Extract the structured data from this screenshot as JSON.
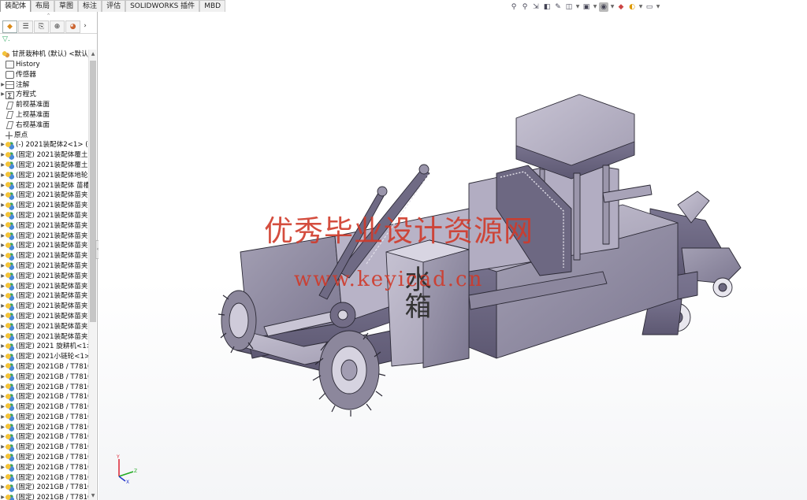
{
  "tabs": [
    "装配体",
    "布局",
    "草图",
    "标注",
    "评估",
    "SOLIDWORKS 插件",
    "MBD"
  ],
  "active_tab": 0,
  "hud_icons": [
    "search-icon",
    "zoom-area-icon",
    "previous-view-icon",
    "section-view-icon",
    "dynamic-annotation-icon",
    "view-orientation-icon",
    "display-style-icon",
    "hide-show-icon",
    "edit-appearance-icon",
    "apply-scene-icon",
    "view-settings-icon"
  ],
  "panel": {
    "tabs": [
      "feature-manager-icon",
      "property-manager-icon",
      "configuration-manager-icon",
      "dimxpert-icon",
      "display-manager-icon"
    ],
    "more": "›",
    "filter": "▽.",
    "root": "甘蔗栽种机 (默认) <默认_显",
    "tree": [
      {
        "icon": "hist",
        "label": "History",
        "arrow": ""
      },
      {
        "icon": "sens",
        "label": "传感器",
        "arrow": ""
      },
      {
        "icon": "note",
        "label": "注解",
        "arrow": "▶"
      },
      {
        "icon": "eq",
        "label": "方程式",
        "arrow": "▶"
      },
      {
        "icon": "plane",
        "label": "前视基准面",
        "arrow": ""
      },
      {
        "icon": "plane",
        "label": "上视基准面",
        "arrow": ""
      },
      {
        "icon": "plane",
        "label": "右视基准面",
        "arrow": ""
      },
      {
        "icon": "origin",
        "label": "原点",
        "arrow": ""
      },
      {
        "icon": "asm",
        "label": "(-) 2021装配体2<1> (默",
        "arrow": "▶"
      },
      {
        "icon": "asm",
        "label": "(固定) 2021装配体覆土",
        "arrow": "▶"
      },
      {
        "icon": "asm",
        "label": "(固定) 2021装配体覆土",
        "arrow": "▶"
      },
      {
        "icon": "asm",
        "label": "(固定) 2021装配体地轮",
        "arrow": "▶"
      },
      {
        "icon": "asm",
        "label": "(固定) 2021装配体 苗槽",
        "arrow": "▶"
      },
      {
        "icon": "asm",
        "label": "(固定) 2021装配体苗夹",
        "arrow": "▶"
      },
      {
        "icon": "asm",
        "label": "(固定) 2021装配体苗夹",
        "arrow": "▶"
      },
      {
        "icon": "asm",
        "label": "(固定) 2021装配体苗夹",
        "arrow": "▶"
      },
      {
        "icon": "asm",
        "label": "(固定) 2021装配体苗夹",
        "arrow": "▶"
      },
      {
        "icon": "asm",
        "label": "(固定) 2021装配体苗夹",
        "arrow": "▶"
      },
      {
        "icon": "asm",
        "label": "(固定) 2021装配体苗夹",
        "arrow": "▶"
      },
      {
        "icon": "asm",
        "label": "(固定) 2021装配体苗夹",
        "arrow": "▶"
      },
      {
        "icon": "asm",
        "label": "(固定) 2021装配体苗夹",
        "arrow": "▶"
      },
      {
        "icon": "asm",
        "label": "(固定) 2021装配体苗夹",
        "arrow": "▶"
      },
      {
        "icon": "asm",
        "label": "(固定) 2021装配体苗夹",
        "arrow": "▶"
      },
      {
        "icon": "asm",
        "label": "(固定) 2021装配体苗夹",
        "arrow": "▶"
      },
      {
        "icon": "asm",
        "label": "(固定) 2021装配体苗夹",
        "arrow": "▶"
      },
      {
        "icon": "asm",
        "label": "(固定) 2021装配体苗夹",
        "arrow": "▶"
      },
      {
        "icon": "asm",
        "label": "(固定) 2021装配体苗夹",
        "arrow": "▶"
      },
      {
        "icon": "asm",
        "label": "(固定) 2021装配体苗夹",
        "arrow": "▶"
      },
      {
        "icon": "asm",
        "label": "(固定) 2021 旋耕机<1>",
        "arrow": "▶"
      },
      {
        "icon": "asm",
        "label": "(固定) 2021小链轮<1>",
        "arrow": "▶"
      },
      {
        "icon": "asm",
        "label": "(固定) 2021GB / T781C",
        "arrow": "▶"
      },
      {
        "icon": "asm",
        "label": "(固定) 2021GB / T781C",
        "arrow": "▶"
      },
      {
        "icon": "asm",
        "label": "(固定) 2021GB / T781C",
        "arrow": "▶"
      },
      {
        "icon": "asm",
        "label": "(固定) 2021GB / T781C",
        "arrow": "▶"
      },
      {
        "icon": "asm",
        "label": "(固定) 2021GB / T781C",
        "arrow": "▶"
      },
      {
        "icon": "asm",
        "label": "(固定) 2021GB / T781C",
        "arrow": "▶"
      },
      {
        "icon": "asm",
        "label": "(固定) 2021GB / T781C",
        "arrow": "▶"
      },
      {
        "icon": "asm",
        "label": "(固定) 2021GB / T781C",
        "arrow": "▶"
      },
      {
        "icon": "asm",
        "label": "(固定) 2021GB / T781C",
        "arrow": "▶"
      },
      {
        "icon": "asm",
        "label": "(固定) 2021GB / T781C",
        "arrow": "▶"
      },
      {
        "icon": "asm",
        "label": "(固定) 2021GB / T781C",
        "arrow": "▶"
      },
      {
        "icon": "asm",
        "label": "(固定) 2021GB / T781C",
        "arrow": "▶"
      },
      {
        "icon": "asm",
        "label": "(固定) 2021GB / T781C",
        "arrow": "▶"
      },
      {
        "icon": "asm",
        "label": "(固定) 2021GB / T781C",
        "arrow": "▶"
      }
    ]
  },
  "viewport": {
    "watermark_cn": "优秀毕业设计资源网",
    "watermark_url": "www.keyicad.cn",
    "tank_label": "水箱",
    "model_color": "#8f8a9e",
    "watermark_color": "#d03a2a",
    "triad": {
      "x": "X",
      "y": "Y",
      "z": "Z"
    }
  }
}
